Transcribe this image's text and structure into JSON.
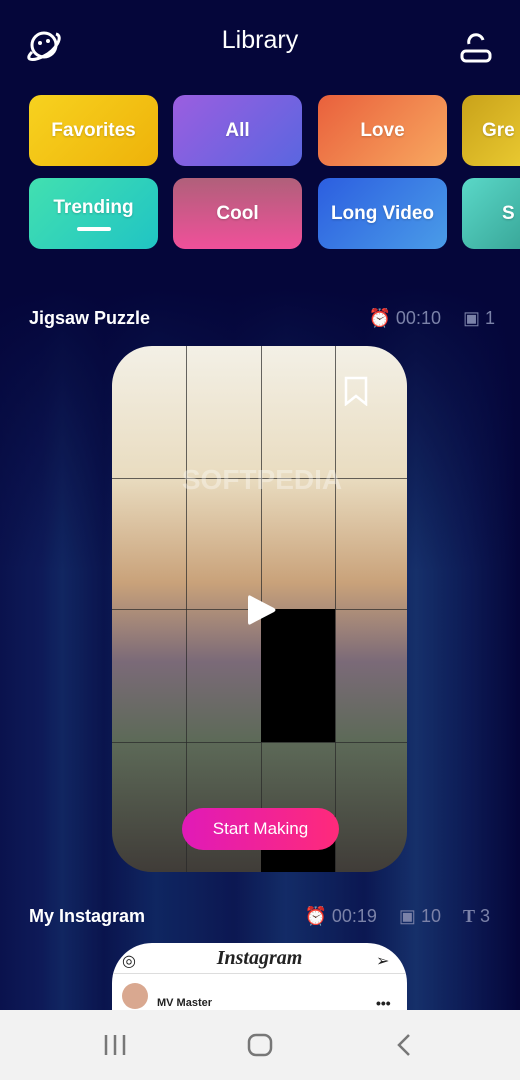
{
  "header": {
    "title": "Library",
    "left_icon": "planet-icon",
    "right_icon": "profile-icon"
  },
  "categories": [
    {
      "label": "Favorites",
      "color": "#f5c41a"
    },
    {
      "label": "All",
      "color": "#7c5ce0"
    },
    {
      "label": "Love",
      "color": "#f48a4e"
    },
    {
      "label": "Gre",
      "color": "#d8b81e"
    },
    {
      "label": "Trending",
      "color": "#2fd6b8",
      "selected": true
    },
    {
      "label": "Cool",
      "color": "#e0608e"
    },
    {
      "label": "Long Video",
      "color": "#3d74e4"
    },
    {
      "label": "S",
      "color": "#5fd8c4"
    }
  ],
  "sections": [
    {
      "title": "Jigsaw Puzzle",
      "duration": "00:10",
      "images": "1",
      "start_label": "Start Making",
      "watermark": "SOFTPEDIA"
    },
    {
      "title": "My Instagram",
      "duration": "00:19",
      "images": "10",
      "texts": "3",
      "preview": {
        "app_name": "Instagram",
        "user": "MV Master"
      }
    }
  ]
}
